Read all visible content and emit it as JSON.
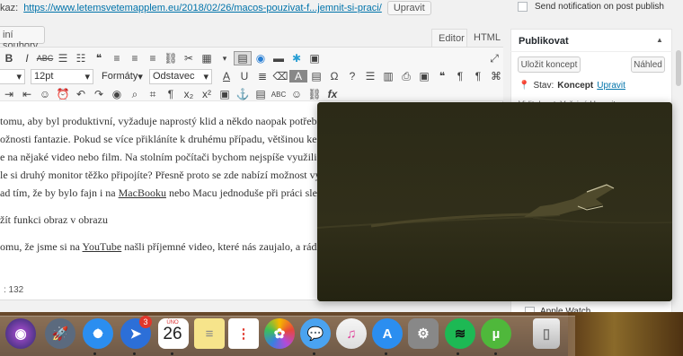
{
  "permalink": {
    "prefix": "kaz:",
    "url": "https://www.letemsvetemapplem.eu/2018/02/26/macos-pouzivat-f...jemnit-si-praci/",
    "edit_button": "Upravit"
  },
  "media_button": "iní soubory",
  "editor_tabs": {
    "editor": "Editor",
    "html": "HTML"
  },
  "toolbar": {
    "font_size": "12pt",
    "formats": "Formáty",
    "paragraph": "Odstavec"
  },
  "content": {
    "paragraphs": [
      "tomu, aby byl produktivní, vyžaduje naprostý klid a někdo naopak potřebuje m",
      "ožnosti fantazie. Pokud se více přikláníte k druhému případu, většinou ke zvýš",
      "e na nějaké video nebo film. Na stolním počítači bychom nejspíše využili druhý",
      "le si druhý monitor těžko připojíte? Přesně proto se zde nabízí možnost využít",
      "ad tím, že by bylo fajn i na MacBooku nebo Macu jednoduše při práci sledovat f",
      "",
      "žít funkci obraz v obrazu",
      "",
      "omu, že jsme si na YouTube našli příjemné video, které nás zaujalo, a rádi bych"
    ],
    "links": [
      "MacBooku",
      "YouTube"
    ]
  },
  "word_count": ": 132",
  "sidebar": {
    "notify_label": "Send notification on post publish",
    "publish_title": "Publikovat",
    "save_draft": "Uložit koncept",
    "preview": "Náhled",
    "status_label": "Stav:",
    "status_value": "Koncept",
    "status_edit": "Upravit",
    "visibility_hint": "Viditelnost: Veřejné Upravit",
    "apple_watch": "Apple Watch"
  },
  "dock": {
    "badge_count": "3",
    "calendar_month": "ÚNO",
    "calendar_day": "26",
    "apps": [
      "siri-icon",
      "launchpad-icon",
      "safari-icon",
      "spark-icon",
      "calendar-icon",
      "notes-icon",
      "reminders-icon",
      "photos-icon",
      "messages-icon",
      "itunes-icon",
      "app-store-icon",
      "system-preferences-icon",
      "spotify-icon",
      "utorrent-icon",
      "trash-icon"
    ]
  },
  "colors": {
    "link": "#0073aa",
    "pip_bg": "#2d2b18"
  }
}
